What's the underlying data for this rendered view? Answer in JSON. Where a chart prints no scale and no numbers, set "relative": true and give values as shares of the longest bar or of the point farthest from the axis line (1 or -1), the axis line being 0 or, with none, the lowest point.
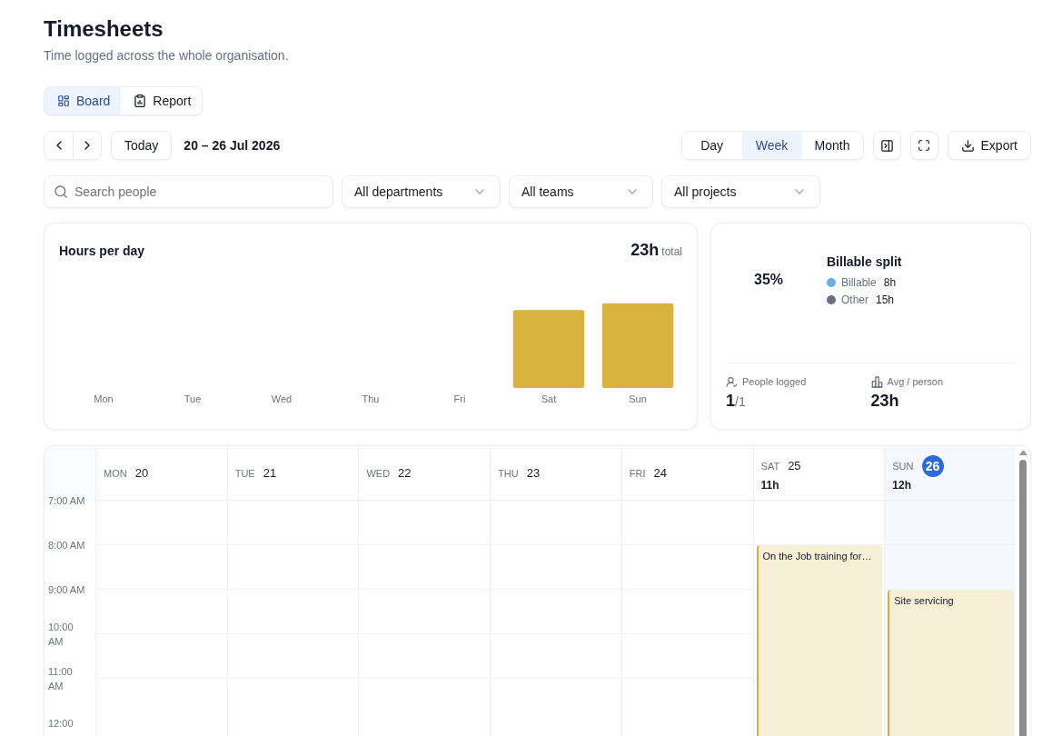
{
  "header": {
    "title": "Timesheets",
    "subtitle": "Time logged across the whole organisation."
  },
  "view_tabs": [
    {
      "label": "Board",
      "selected": true
    },
    {
      "label": "Report",
      "selected": false
    }
  ],
  "toolbar": {
    "today_button": "Today",
    "date_range": "20 – 26 Jul 2026",
    "range_tabs": [
      {
        "label": "Day",
        "selected": false
      },
      {
        "label": "Week",
        "selected": true
      },
      {
        "label": "Month",
        "selected": false
      }
    ],
    "export_button": "Export"
  },
  "filters": {
    "search": {
      "placeholder": "Search people"
    },
    "dropdowns": [
      {
        "value": "All departments"
      },
      {
        "value": "All teams"
      },
      {
        "value": "All projects"
      }
    ]
  },
  "hours_card": {
    "title": "Hours per day",
    "total": "23h",
    "total_label": "total",
    "chart_data": {
      "type": "bar",
      "relative": true,
      "categories": [
        "Mon",
        "Tue",
        "Wed",
        "Thu",
        "Fri",
        "Sat",
        "Sun"
      ],
      "values": [
        0,
        0,
        0,
        0,
        0,
        0.92,
        1
      ]
    }
  },
  "billable_card": {
    "percentage": "35%",
    "title": "Billable split",
    "legend": [
      {
        "label": "Billable",
        "value": "8h",
        "color": "#6aaee8"
      },
      {
        "label": "Other",
        "value": "15h",
        "color": "#6b7080"
      }
    ],
    "stats": [
      {
        "label": "People logged",
        "value": "1",
        "suffix": "/1"
      },
      {
        "label": "Avg / person",
        "value": "23h"
      }
    ]
  },
  "calendar": {
    "hours": [
      "7:00 AM",
      "8:00 AM",
      "9:00 AM",
      "10:00 AM",
      "11:00 AM",
      "12:00"
    ],
    "days": [
      {
        "weekday": "MON",
        "date": "20",
        "today": false,
        "slots": [
          {
            "busy": false
          },
          {
            "busy": false
          },
          {
            "busy": false
          },
          {
            "busy": false
          },
          {
            "busy": false
          }
        ]
      },
      {
        "weekday": "TUE",
        "date": "21",
        "today": false,
        "slots": [
          {
            "busy": false
          },
          {
            "busy": false
          },
          {
            "busy": false
          },
          {
            "busy": false
          },
          {
            "busy": false
          }
        ]
      },
      {
        "weekday": "WED",
        "date": "22",
        "today": false,
        "slots": [
          {
            "busy": false
          },
          {
            "busy": false
          },
          {
            "busy": false
          },
          {
            "busy": false
          },
          {
            "busy": false
          }
        ]
      },
      {
        "weekday": "THU",
        "date": "23",
        "today": false,
        "slots": [
          {
            "busy": false
          },
          {
            "busy": false
          },
          {
            "busy": false
          },
          {
            "busy": false
          },
          {
            "busy": false
          }
        ]
      },
      {
        "weekday": "FRI",
        "date": "24",
        "today": false,
        "slots": [
          {
            "busy": false
          },
          {
            "busy": false
          },
          {
            "busy": false
          },
          {
            "busy": false
          },
          {
            "busy": false
          }
        ]
      },
      {
        "weekday": "SAT",
        "date": "25",
        "today": false,
        "total": "11h",
        "slots": [
          {
            "busy": false
          },
          {
            "busy": true,
            "title": "On the Job training for…"
          },
          {
            "busy": true
          },
          {
            "busy": true
          },
          {
            "busy": true
          }
        ]
      },
      {
        "weekday": "SUN",
        "date": "26",
        "today": true,
        "total": "12h",
        "slots": [
          {
            "busy": false
          },
          {
            "busy": false
          },
          {
            "busy": true,
            "title": "Site servicing"
          },
          {
            "busy": true
          },
          {
            "busy": true
          }
        ]
      }
    ]
  }
}
